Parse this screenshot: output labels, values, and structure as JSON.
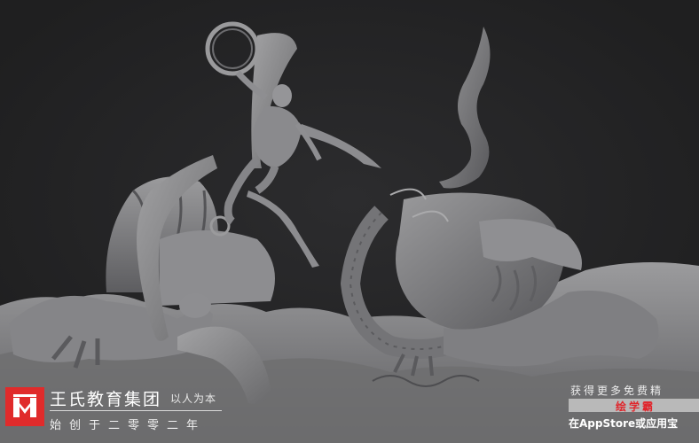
{
  "artwork": {
    "subject": "sculpt-warrior-vs-dragon",
    "background_color": "#232324",
    "sculpt_color": "#8a8a8c"
  },
  "brand": {
    "logo_icon": "wangs-logo-icon",
    "logo_color": "#e02b2b",
    "name": "王氏教育集团",
    "slogan": "以人为本",
    "subtitle": "始创于二零零二年"
  },
  "promo": {
    "top_text": "获得更多免费精",
    "app_name": "绘学霸",
    "bottom_text": "在AppStore或应用宝",
    "accent_color": "#e0262c"
  }
}
